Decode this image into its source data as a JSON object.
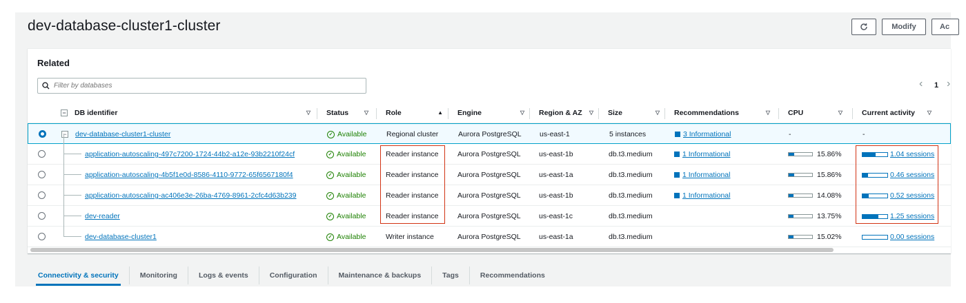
{
  "header": {
    "title": "dev-database-cluster1-cluster",
    "modify_label": "Modify",
    "actions_label": "Ac"
  },
  "related": {
    "heading": "Related",
    "filter_placeholder": "Filter by databases",
    "page_number": "1",
    "prev_glyph": "‹",
    "next_glyph": "›"
  },
  "columns": [
    "DB identifier",
    "Status",
    "Role",
    "Engine",
    "Region & AZ",
    "Size",
    "Recommendations",
    "CPU",
    "Current activity"
  ],
  "sort_glyphs": {
    "desc": "▽",
    "asc": "▲"
  },
  "rows": [
    {
      "id": "dev-database-cluster1-cluster",
      "status": "Available",
      "role": "Regional cluster",
      "engine": "Aurora PostgreSQL",
      "region": "us-east-1",
      "size": "5 instances",
      "recommendation": "3 Informational",
      "cpu_text": "-",
      "cpu_fraction": null,
      "activity_text": "-",
      "activity_fraction": null
    },
    {
      "id": "application-autoscaling-497c7200-1724-44b2-a12e-93b2210f24cf",
      "status": "Available",
      "role": "Reader instance",
      "engine": "Aurora PostgreSQL",
      "region": "us-east-1b",
      "size": "db.t3.medium",
      "recommendation": "1 Informational",
      "cpu_text": "15.86%",
      "cpu_fraction": 0.1586,
      "activity_text": "1.04 sessions",
      "activity_fraction": 0.52
    },
    {
      "id": "application-autoscaling-4b5f1e0d-8586-4110-9772-65f6567180f4",
      "status": "Available",
      "role": "Reader instance",
      "engine": "Aurora PostgreSQL",
      "region": "us-east-1a",
      "size": "db.t3.medium",
      "recommendation": "1 Informational",
      "cpu_text": "15.86%",
      "cpu_fraction": 0.1586,
      "activity_text": "0.46 sessions",
      "activity_fraction": 0.23
    },
    {
      "id": "application-autoscaling-ac406e3e-26ba-4769-8961-2cfc4d63b239",
      "status": "Available",
      "role": "Reader instance",
      "engine": "Aurora PostgreSQL",
      "region": "us-east-1b",
      "size": "db.t3.medium",
      "recommendation": "1 Informational",
      "cpu_text": "14.08%",
      "cpu_fraction": 0.1408,
      "activity_text": "0.52 sessions",
      "activity_fraction": 0.26
    },
    {
      "id": "dev-reader",
      "status": "Available",
      "role": "Reader instance",
      "engine": "Aurora PostgreSQL",
      "region": "us-east-1c",
      "size": "db.t3.medium",
      "recommendation": "",
      "cpu_text": "13.75%",
      "cpu_fraction": 0.1375,
      "activity_text": "1.25 sessions",
      "activity_fraction": 0.625
    },
    {
      "id": "dev-database-cluster1",
      "status": "Available",
      "role": "Writer instance",
      "engine": "Aurora PostgreSQL",
      "region": "us-east-1a",
      "size": "db.t3.medium",
      "recommendation": "",
      "cpu_text": "15.02%",
      "cpu_fraction": 0.1502,
      "activity_text": "0.00 sessions",
      "activity_fraction": 0.0
    }
  ],
  "tabs": [
    "Connectivity & security",
    "Monitoring",
    "Logs & events",
    "Configuration",
    "Maintenance & backups",
    "Tags",
    "Recommendations"
  ],
  "colors": {
    "accent": "#0073bb",
    "available": "#1d8102",
    "highlight": "#d13212"
  }
}
